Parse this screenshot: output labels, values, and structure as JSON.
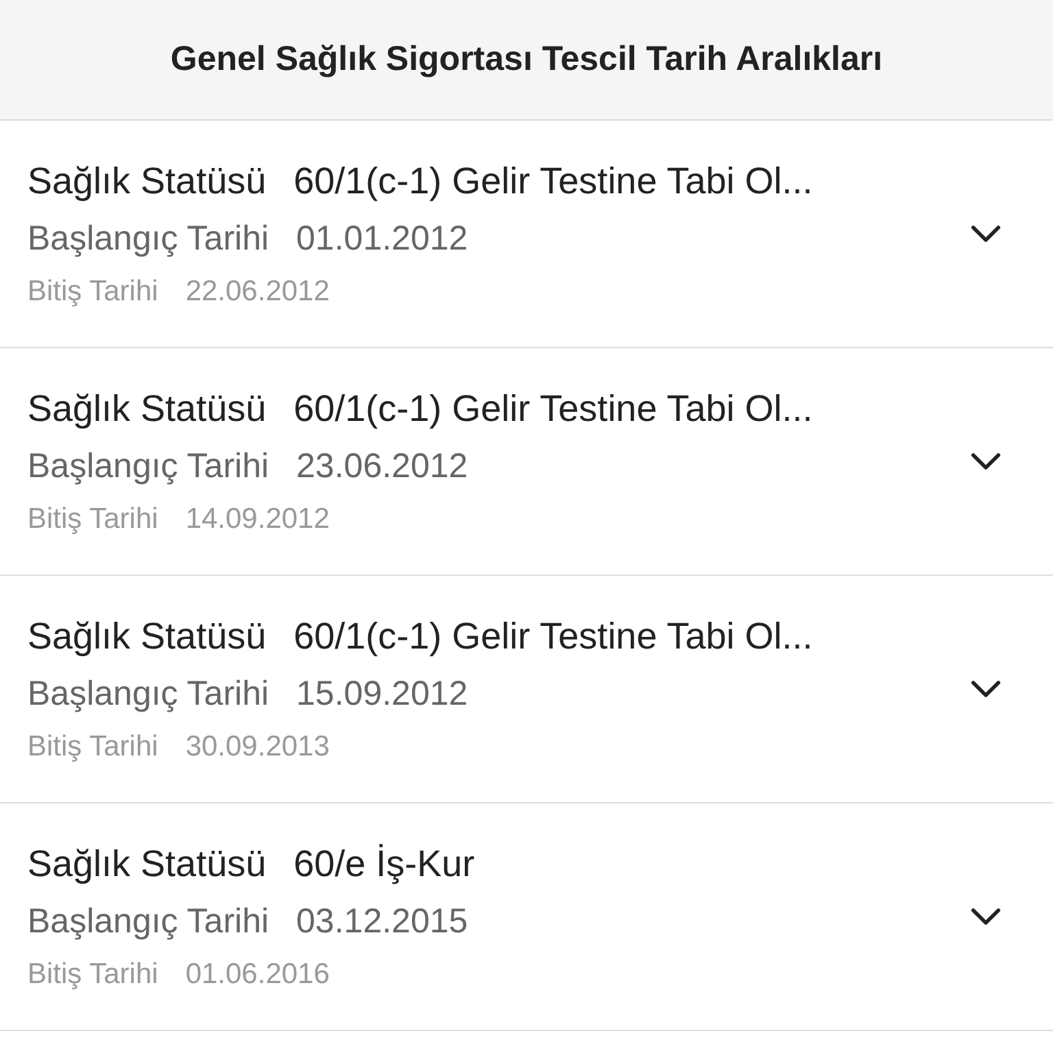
{
  "header": {
    "title": "Genel Sağlık Sigortası Tescil Tarih Aralıkları"
  },
  "records": [
    {
      "status_label": "Sağlık Statüsü",
      "status": "60/1(c-1) Gelir Testine Tabi Ol...",
      "start_label": "Başlangıç Tarihi",
      "start": "01.01.2012",
      "end_label": "Bitiş Tarihi",
      "end": "22.06.2012",
      "expanded": false
    },
    {
      "status_label": "Sağlık Statüsü",
      "status": "60/1(c-1) Gelir Testine Tabi Ol...",
      "start_label": "Başlangıç Tarihi",
      "start": "23.06.2012",
      "end_label": "Bitiş Tarihi",
      "end": "14.09.2012",
      "expanded": false
    },
    {
      "status_label": "Sağlık Statüsü",
      "status": "60/1(c-1) Gelir Testine Tabi Ol...",
      "start_label": "Başlangıç Tarihi",
      "start": "15.09.2012",
      "end_label": "Bitiş Tarihi",
      "end": "30.09.2013",
      "expanded": false
    },
    {
      "status_label": "Sağlık Statüsü",
      "status": "60/e İş-Kur",
      "start_label": "Başlangıç Tarihi",
      "start": "03.12.2015",
      "end_label": "Bitiş Tarihi",
      "end": "01.06.2016",
      "expanded": false
    }
  ]
}
